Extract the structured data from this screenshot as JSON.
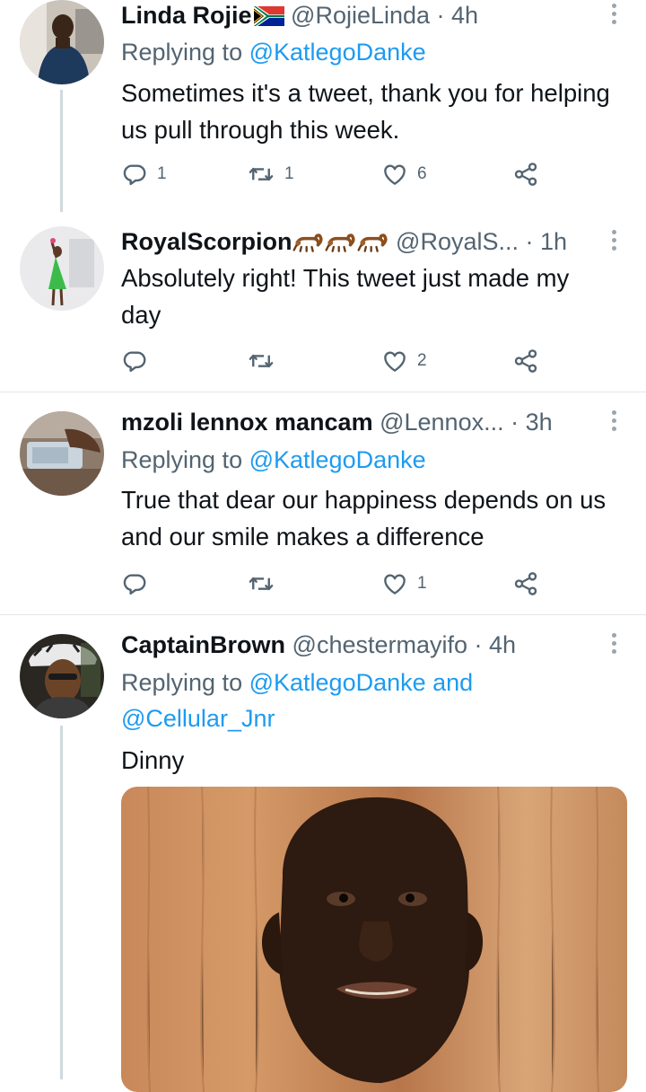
{
  "tweets": [
    {
      "name": "Linda Rojie",
      "handle": "@RojieLinda",
      "time": "· 4h",
      "replying_label": "Replying to",
      "replying_to": "@KatlegoDanke",
      "text": "Sometimes it's a tweet, thank you for helping us pull through this week.",
      "replies": "1",
      "retweets": "1",
      "likes": "6",
      "name_emoji": "south-africa-flag-icon"
    },
    {
      "name": "RoyalScorpion",
      "handle": "@RoyalS...",
      "time": "· 1h",
      "text": "Absolutely right! This tweet just made my day",
      "replies": "",
      "retweets": "",
      "likes": "2",
      "name_emoji": "scorpion-icon"
    },
    {
      "name": "mzoli lennox mancam",
      "handle": "@Lennox...",
      "time": "· 3h",
      "replying_label": "Replying to",
      "replying_to": "@KatlegoDanke",
      "text": "True that dear our happiness depends on us and our smile makes a difference",
      "replies": "",
      "retweets": "",
      "likes": "1"
    },
    {
      "name": "CaptainBrown",
      "handle": "@chestermayifo",
      "time": "· 4h",
      "replying_label": "Replying to",
      "replying_to": "@KatlegoDanke and",
      "replying_to_2": "@Cellular_Jnr",
      "text": "Dinny",
      "media": "photo"
    }
  ],
  "colors": {
    "text": "#0f1419",
    "secondary": "#536471",
    "accent": "#1d9bf0",
    "divider": "#e3e6e9",
    "icon": "#536471"
  },
  "icons": [
    "reply-icon",
    "retweet-icon",
    "like-icon",
    "share-icon",
    "more-icon"
  ]
}
